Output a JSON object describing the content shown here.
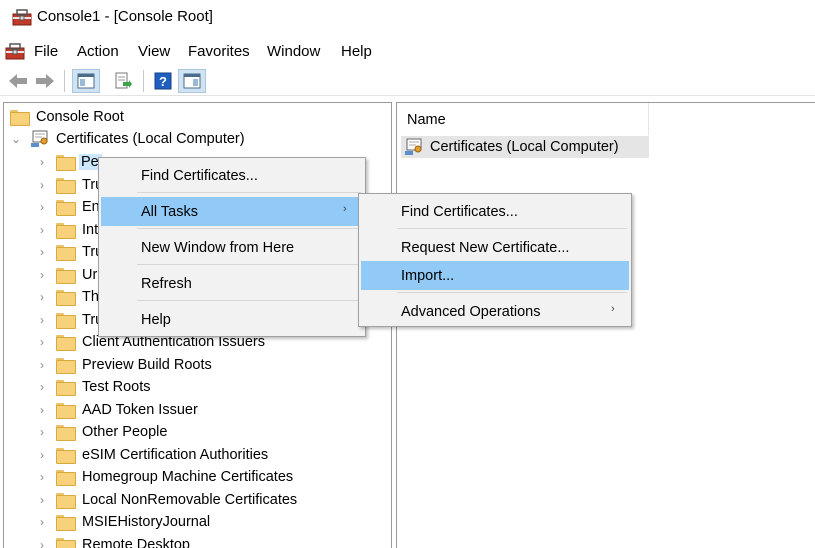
{
  "window": {
    "title": "Console1 - [Console Root]"
  },
  "menu": [
    "File",
    "Action",
    "View",
    "Favorites",
    "Window",
    "Help"
  ],
  "toolbar": {
    "buttons": [
      "back-icon",
      "forward-icon",
      "show-hide-console-tree-icon",
      "export-list-icon",
      "help-icon",
      "show-hide-action-pane-icon"
    ]
  },
  "tree": {
    "root": "Console Root",
    "store": "Certificates (Local Computer)",
    "items": [
      "Personal",
      "Trusted Root Certification Authorities",
      "Enterprise Trust",
      "Intermediate Certification Authorities",
      "Trusted Publishers",
      "Untrusted Certificates",
      "Third-Party Root Certification Authorities",
      "Trusted People",
      "Client Authentication Issuers",
      "Preview Build Roots",
      "Test Roots",
      "AAD Token Issuer",
      "Other People",
      "eSIM Certification Authorities",
      "Homegroup Machine Certificates",
      "Local NonRemovable Certificates",
      "MSIEHistoryJournal",
      "Remote Desktop"
    ],
    "visible_labels": [
      "Pe",
      "Tru",
      "En",
      "Int",
      "Tru",
      "Ur",
      "Th",
      "Tru",
      "Client Authentication Issuers",
      "Preview Build Roots",
      "Test Roots",
      "AAD Token Issuer",
      "Other People",
      "eSIM Certification Authorities",
      "Homegroup Machine Certificates",
      "Local NonRemovable Certificates",
      "MSIEHistoryJournal",
      "Remote Desktop"
    ]
  },
  "list": {
    "column_name": "Name",
    "rows": [
      "Certificates (Local Computer)"
    ]
  },
  "context_menu": {
    "items": [
      "Find Certificates...",
      "All Tasks",
      "New Window from Here",
      "Refresh",
      "Help"
    ],
    "highlighted": "All Tasks"
  },
  "submenu": {
    "items": [
      "Find Certificates...",
      "Request New Certificate...",
      "Import...",
      "Advanced Operations"
    ],
    "highlighted": "Import..."
  },
  "colors": {
    "highlight": "#91c9f7",
    "selection": "#cce8ff",
    "menu_bg": "#f2f2f2"
  }
}
